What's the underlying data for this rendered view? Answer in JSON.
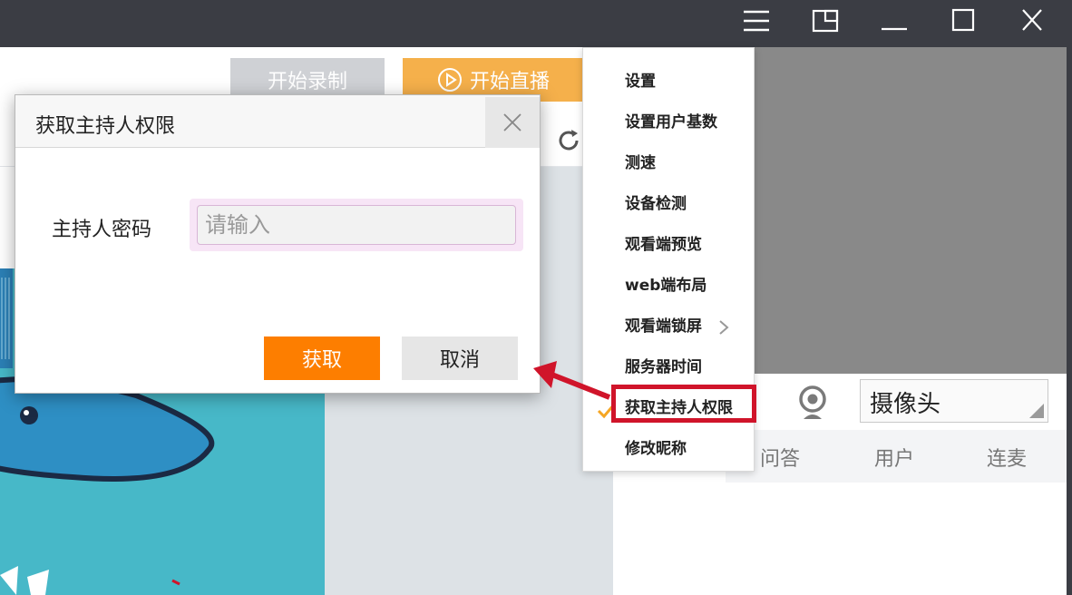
{
  "toolbar": {
    "record_label": "开始录制",
    "live_label": "开始直播"
  },
  "menu": {
    "items": [
      {
        "label": "设置"
      },
      {
        "label": "设置用户基数"
      },
      {
        "label": "测速"
      },
      {
        "label": "设备检测"
      },
      {
        "label": "观看端预览"
      },
      {
        "label": "web端布局"
      },
      {
        "label": "观看端锁屏"
      },
      {
        "label": "服务器时间"
      },
      {
        "label": "获取主持人权限"
      },
      {
        "label": "修改昵称"
      }
    ],
    "checked_item": "服务器时间",
    "highlighted_item": "获取主持人权限"
  },
  "dialog": {
    "title": "获取主持人权限",
    "password_label": "主持人密码",
    "password_placeholder": "请输入",
    "confirm_label": "获取",
    "cancel_label": "取消"
  },
  "right_panel": {
    "camera_select_value": "摄像头",
    "tabs": [
      {
        "label": "问答"
      },
      {
        "label": "用户"
      },
      {
        "label": "连麦"
      }
    ]
  },
  "colors": {
    "titlebar": "#3b3d44",
    "accent_orange": "#fd7e00",
    "live_button": "#f5b04b",
    "highlight_red": "#d0142a",
    "check_orange": "#f5a623"
  },
  "icons": {
    "menu": "hamburger-menu-icon",
    "layout": "layout-toggle-icon",
    "minimize": "minimize-icon",
    "maximize": "maximize-icon",
    "close": "close-icon",
    "play": "play-circle-icon",
    "refresh": "refresh-icon",
    "camera": "webcam-icon",
    "check": "checkmark-icon",
    "chevron": "chevron-right-icon"
  }
}
